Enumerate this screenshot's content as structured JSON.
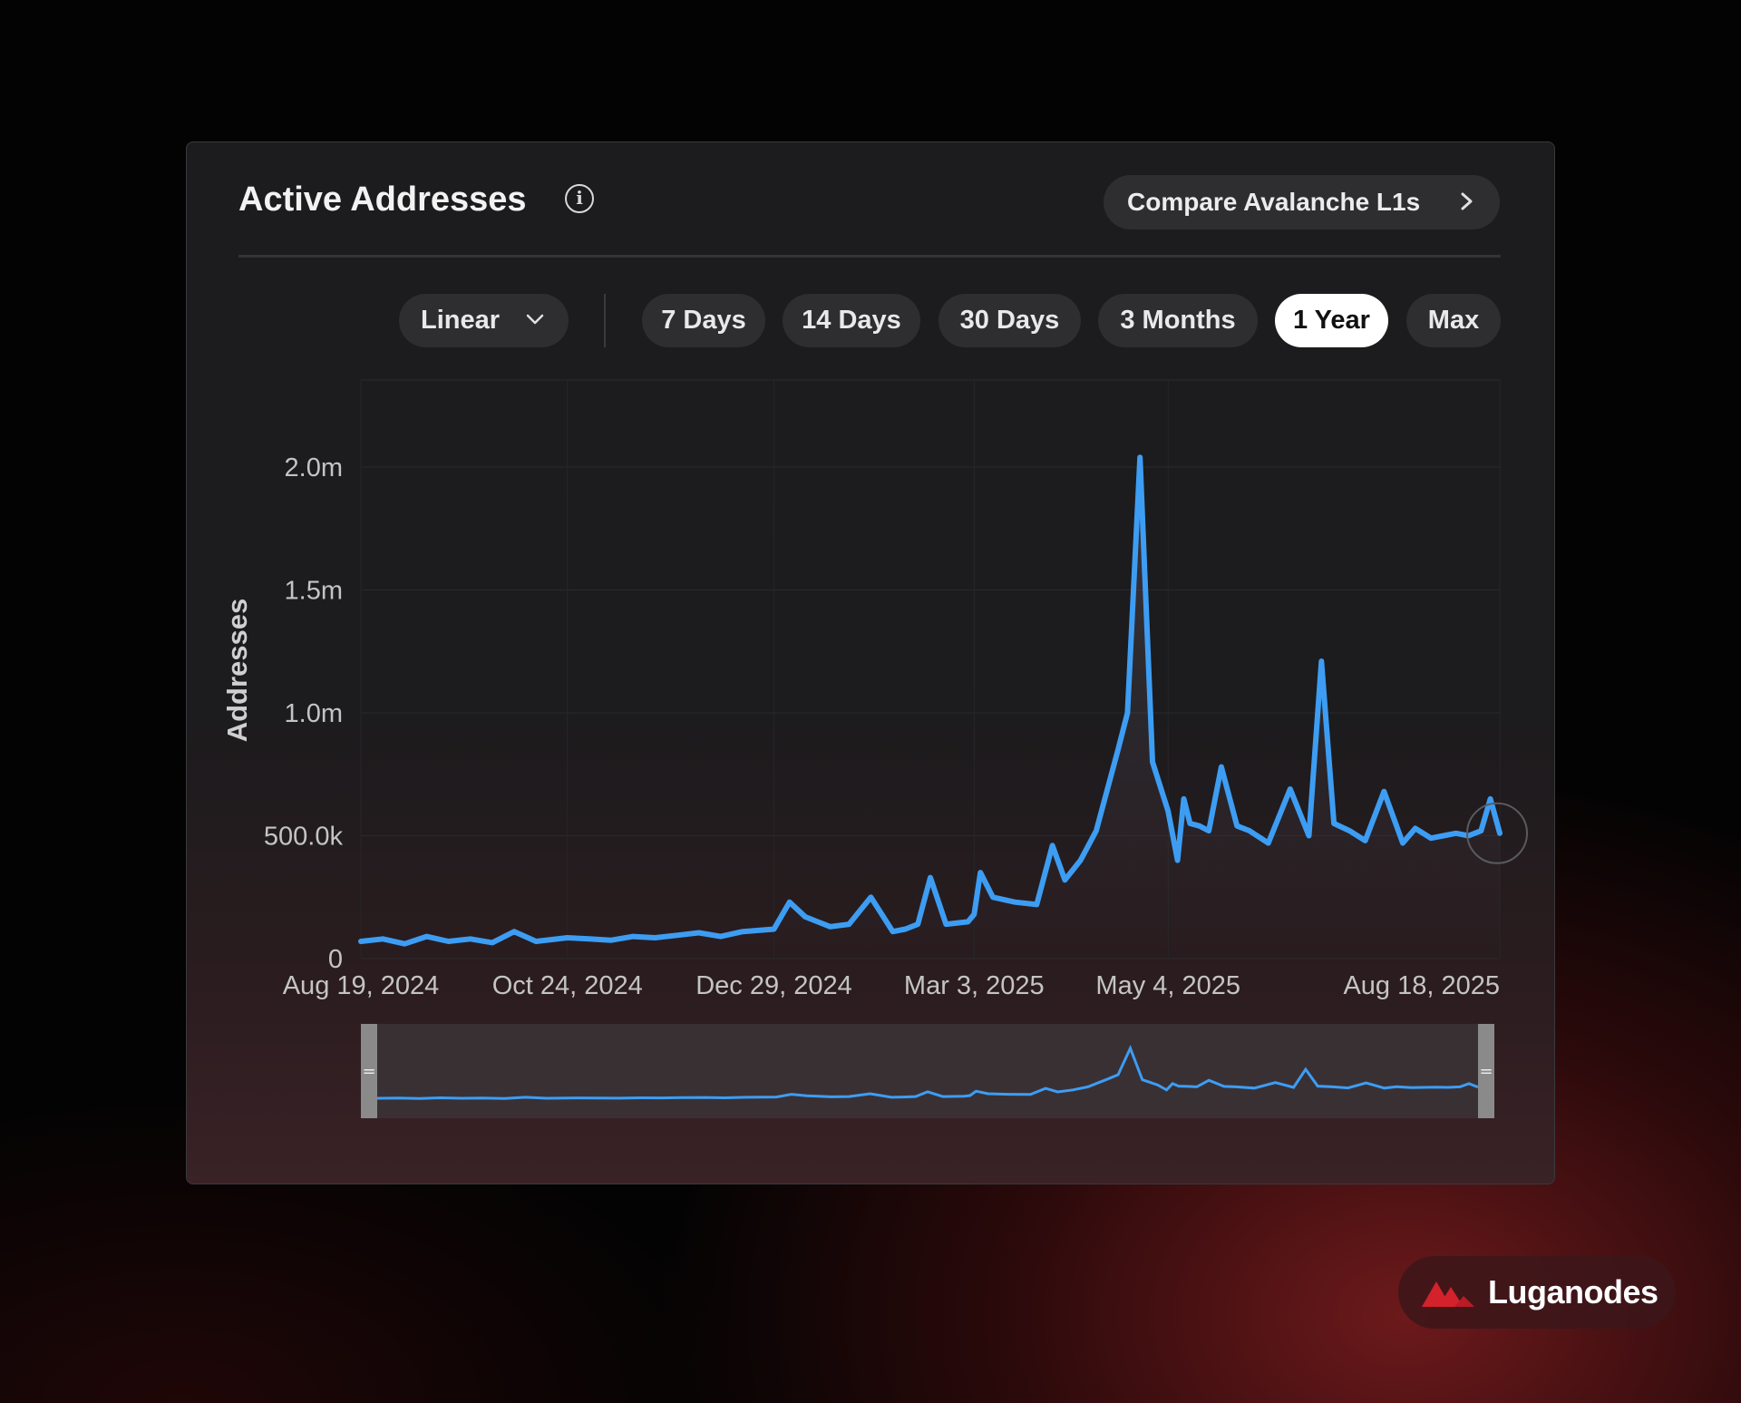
{
  "card": {
    "title": "Active Addresses",
    "info_icon": "info-icon",
    "compare_button_label": "Compare Avalanche L1s",
    "compare_button_icon": "chevron-right-icon"
  },
  "controls": {
    "scale_select": {
      "label": "Linear",
      "icon": "chevron-down-icon"
    },
    "ranges": [
      {
        "label": "7 Days",
        "active": false
      },
      {
        "label": "14 Days",
        "active": false
      },
      {
        "label": "30 Days",
        "active": false
      },
      {
        "label": "3 Months",
        "active": false
      },
      {
        "label": "1 Year",
        "active": true
      },
      {
        "label": "Max",
        "active": false
      }
    ]
  },
  "brand": {
    "name": "Luganodes",
    "logo_icon": "luganodes-logo-icon"
  },
  "colors": {
    "line": "#3d9df3",
    "active_pill_bg": "#ffffff",
    "pill_bg": "#2e2e31"
  },
  "chart_data": {
    "type": "line",
    "title": "",
    "xlabel": "",
    "ylabel": "Addresses",
    "x_tick_labels": [
      "Aug 19, 2024",
      "Oct 24, 2024",
      "Dec 29, 2024",
      "Mar 3, 2025",
      "May 4, 2025",
      "Aug 18, 2025"
    ],
    "y_tick_labels": [
      "0",
      "500.0k",
      "1.0m",
      "1.5m",
      "2.0m"
    ],
    "ylim": [
      0,
      2000000
    ],
    "grid": true,
    "legend": "none",
    "range_slider": true,
    "series": [
      {
        "x": [
          "2024-08-19",
          "2024-08-26",
          "2024-09-02",
          "2024-09-09",
          "2024-09-16",
          "2024-09-23",
          "2024-09-30",
          "2024-10-07",
          "2024-10-14",
          "2024-10-24",
          "2024-10-31",
          "2024-11-07",
          "2024-11-14",
          "2024-11-21",
          "2024-11-28",
          "2024-12-05",
          "2024-12-12",
          "2024-12-19",
          "2024-12-29",
          "2025-01-03",
          "2025-01-08",
          "2025-01-12",
          "2025-01-16",
          "2025-01-22",
          "2025-01-29",
          "2025-02-05",
          "2025-02-09",
          "2025-02-13",
          "2025-02-17",
          "2025-02-22",
          "2025-03-01",
          "2025-03-03",
          "2025-03-05",
          "2025-03-09",
          "2025-03-16",
          "2025-03-23",
          "2025-03-28",
          "2025-04-01",
          "2025-04-06",
          "2025-04-11",
          "2025-04-18",
          "2025-04-21",
          "2025-04-25",
          "2025-04-29",
          "2025-05-04",
          "2025-05-07",
          "2025-05-09",
          "2025-05-11",
          "2025-05-14",
          "2025-05-17",
          "2025-05-21",
          "2025-05-26",
          "2025-05-30",
          "2025-06-05",
          "2025-06-12",
          "2025-06-18",
          "2025-06-22",
          "2025-06-26",
          "2025-07-01",
          "2025-07-06",
          "2025-07-12",
          "2025-07-18",
          "2025-07-22",
          "2025-07-27",
          "2025-07-31",
          "2025-08-04",
          "2025-08-08",
          "2025-08-12",
          "2025-08-15",
          "2025-08-18"
        ],
        "y": [
          70000,
          80000,
          60000,
          90000,
          70000,
          80000,
          65000,
          110000,
          70000,
          85000,
          80000,
          75000,
          90000,
          85000,
          95000,
          105000,
          90000,
          110000,
          120000,
          230000,
          170000,
          150000,
          130000,
          140000,
          250000,
          110000,
          120000,
          140000,
          330000,
          140000,
          150000,
          180000,
          350000,
          250000,
          230000,
          220000,
          460000,
          320000,
          400000,
          520000,
          850000,
          1000000,
          2040000,
          800000,
          600000,
          400000,
          650000,
          550000,
          540000,
          520000,
          780000,
          540000,
          520000,
          470000,
          690000,
          500000,
          1210000,
          550000,
          520000,
          480000,
          680000,
          470000,
          530000,
          490000,
          500000,
          510000,
          500000,
          520000,
          650000,
          510000
        ]
      }
    ]
  }
}
